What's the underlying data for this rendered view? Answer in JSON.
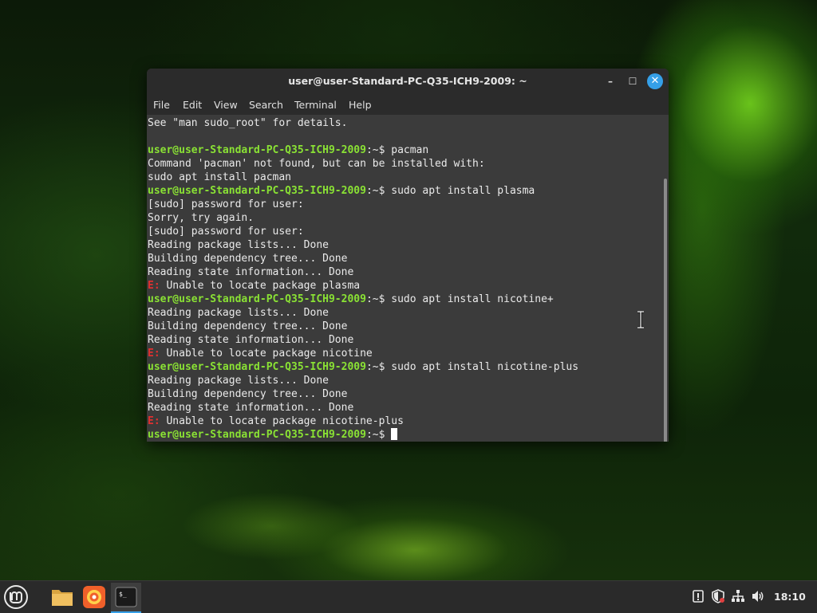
{
  "window": {
    "title": "user@user-Standard-PC-Q35-ICH9-2009: ~",
    "minimize_glyph": "–",
    "maximize_glyph": "☐",
    "close_glyph": "✕"
  },
  "menu": {
    "items": [
      "File",
      "Edit",
      "View",
      "Search",
      "Terminal",
      "Help"
    ]
  },
  "terminal": {
    "prompt_user": "user@user-Standard-PC-Q35-ICH9-2009",
    "prompt_suffix": ":~$ ",
    "error_marker": "E:",
    "lines": [
      {
        "kind": "text",
        "text": "See \"man sudo_root\" for details."
      },
      {
        "kind": "text",
        "text": ""
      },
      {
        "kind": "prompt",
        "text": "pacman"
      },
      {
        "kind": "text",
        "text": "Command 'pacman' not found, but can be installed with:"
      },
      {
        "kind": "text",
        "text": "sudo apt install pacman"
      },
      {
        "kind": "prompt",
        "text": "sudo apt install plasma"
      },
      {
        "kind": "text",
        "text": "[sudo] password for user:"
      },
      {
        "kind": "text",
        "text": "Sorry, try again."
      },
      {
        "kind": "text",
        "text": "[sudo] password for user:"
      },
      {
        "kind": "text",
        "text": "Reading package lists... Done"
      },
      {
        "kind": "text",
        "text": "Building dependency tree... Done"
      },
      {
        "kind": "text",
        "text": "Reading state information... Done"
      },
      {
        "kind": "error",
        "text": " Unable to locate package plasma"
      },
      {
        "kind": "prompt",
        "text": "sudo apt install nicotine+"
      },
      {
        "kind": "text",
        "text": "Reading package lists... Done"
      },
      {
        "kind": "text",
        "text": "Building dependency tree... Done"
      },
      {
        "kind": "text",
        "text": "Reading state information... Done"
      },
      {
        "kind": "error",
        "text": " Unable to locate package nicotine"
      },
      {
        "kind": "prompt",
        "text": "sudo apt install nicotine-plus"
      },
      {
        "kind": "text",
        "text": "Reading package lists... Done"
      },
      {
        "kind": "text",
        "text": "Building dependency tree... Done"
      },
      {
        "kind": "text",
        "text": "Reading state information... Done"
      },
      {
        "kind": "error",
        "text": " Unable to locate package nicotine-plus"
      },
      {
        "kind": "prompt-current",
        "text": ""
      }
    ]
  },
  "taskbar": {
    "launchers": [
      "mint-menu-icon",
      "folder-icon",
      "firefox-icon",
      "terminal-icon"
    ],
    "tray": [
      "update-manager-icon",
      "shield-icon",
      "network-icon",
      "volume-icon"
    ],
    "clock": "18:10"
  },
  "colors": {
    "prompt": "#8ae234",
    "error": "#e03030",
    "accent": "#35a0e8"
  }
}
